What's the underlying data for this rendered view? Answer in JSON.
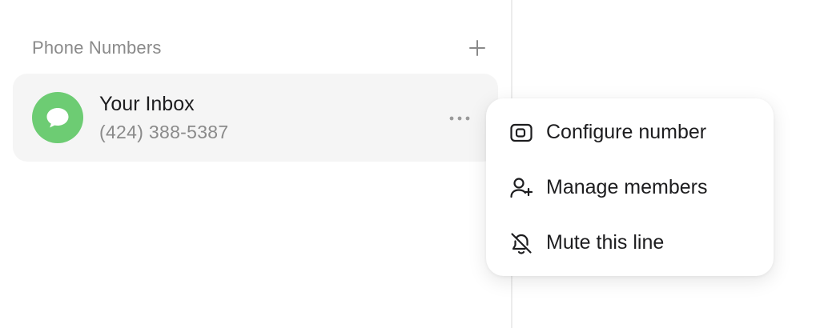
{
  "sidebar": {
    "section_title": "Phone Numbers",
    "add_icon": "plus-icon",
    "inbox": {
      "name": "Your Inbox",
      "number": "(424) 388-5387",
      "avatar_icon": "chat-bubble-icon",
      "avatar_color": "#6dcc73",
      "more_icon": "more-horizontal-icon"
    }
  },
  "context_menu": {
    "items": [
      {
        "label": "Configure number",
        "icon": "sim-card-icon"
      },
      {
        "label": "Manage members",
        "icon": "user-plus-icon"
      },
      {
        "label": "Mute this line",
        "icon": "bell-off-icon"
      }
    ]
  },
  "colors": {
    "row_background": "#f5f5f5",
    "muted_text": "#8a8a8a",
    "primary_text": "#1d1d1f"
  }
}
